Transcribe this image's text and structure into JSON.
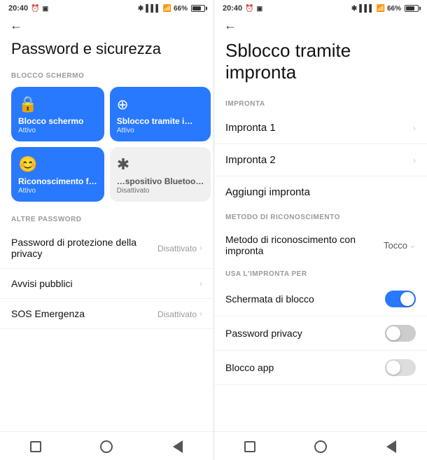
{
  "left_panel": {
    "status": {
      "time": "20:40",
      "battery": "66%"
    },
    "page_title": "Password e sicurezza",
    "section_blocco": "BLOCCO SCHERMO",
    "tiles": [
      {
        "id": "blocco-schermo",
        "icon": "🔒",
        "title": "Blocco schermo",
        "status": "Attivo",
        "active": true
      },
      {
        "id": "sblocco-impronta",
        "icon": "☉",
        "title": "Sblocco tramite i…",
        "status": "Attivo",
        "active": true
      },
      {
        "id": "riconoscimento",
        "icon": "😊",
        "title": "Riconoscimento f…",
        "status": "Attivo",
        "active": true
      },
      {
        "id": "bluetooth",
        "icon": "✱",
        "title": "…spositivo Bluetoo…",
        "status": "Disattivato",
        "active": false
      }
    ],
    "section_altre": "ALTRE PASSWORD",
    "list_items": [
      {
        "id": "privacy-password",
        "title": "Password di protezione della privacy",
        "value": "Disattivato",
        "has_chevron": true
      },
      {
        "id": "avvisi-pubblici",
        "title": "Avvisi pubblici",
        "value": "",
        "has_chevron": true
      },
      {
        "id": "sos-emergenza",
        "title": "SOS Emergenza",
        "value": "Disattivato",
        "has_chevron": true
      }
    ]
  },
  "right_panel": {
    "status": {
      "time": "20:40",
      "battery": "66%"
    },
    "page_title": "Sblocco tramite impronta",
    "section_impronta": "IMPRONTA",
    "fingerprints": [
      {
        "id": "impronta-1",
        "label": "Impronta 1"
      },
      {
        "id": "impronta-2",
        "label": "Impronta 2"
      }
    ],
    "add_label": "Aggiungi impronta",
    "section_metodo": "METODO DI RICONOSCIMENTO",
    "method_label": "Metodo di riconoscimento con impronta",
    "method_value": "Tocco",
    "section_usa": "USA L'IMPRONTA PER",
    "use_for_items": [
      {
        "id": "schermata-blocco",
        "label": "Schermata di blocco",
        "toggle": "on"
      },
      {
        "id": "password-privacy",
        "label": "Password privacy",
        "toggle": "off"
      },
      {
        "id": "blocco-app",
        "label": "Blocco app",
        "toggle": "off-dim"
      }
    ]
  },
  "nav": {
    "square": "■",
    "circle": "●",
    "back": "◀"
  }
}
